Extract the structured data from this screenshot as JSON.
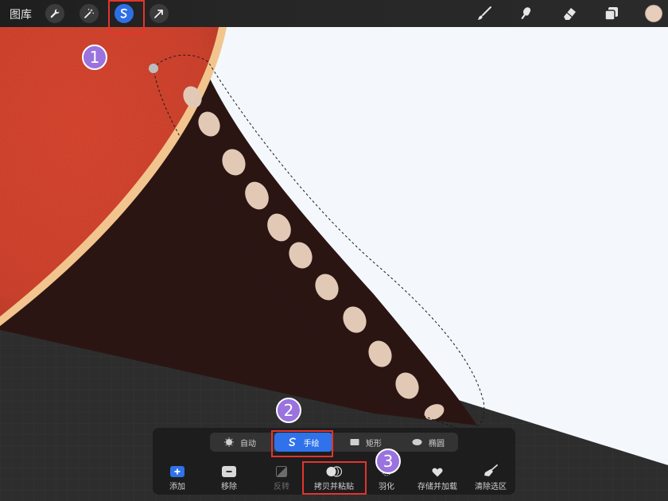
{
  "topbar": {
    "gallery_label": "图库",
    "tools": [
      "wrench-icon",
      "magic-wand-icon",
      "selection-icon",
      "transform-icon"
    ],
    "right_tools": [
      "brush-icon",
      "smudge-icon",
      "eraser-icon",
      "layers-icon"
    ],
    "current_color": "#e7cdbb",
    "active_tool": "selection"
  },
  "selection_panel": {
    "modes": [
      {
        "label": "自动",
        "icon": "auto-icon"
      },
      {
        "label": "手绘",
        "icon": "freehand-icon"
      },
      {
        "label": "矩形",
        "icon": "rectangle-icon"
      },
      {
        "label": "椭圆",
        "icon": "ellipse-icon"
      }
    ],
    "active_mode": "手绘",
    "actions": [
      {
        "label": "添加",
        "icon": "add-icon"
      },
      {
        "label": "移除",
        "icon": "remove-icon"
      },
      {
        "label": "反转",
        "icon": "invert-icon"
      },
      {
        "label": "拷贝并粘贴",
        "icon": "copy-paste-icon"
      },
      {
        "label": "羽化",
        "icon": "feather-icon"
      },
      {
        "label": "存储并加载",
        "icon": "heart-icon"
      },
      {
        "label": "清除选区",
        "icon": "broom-icon"
      }
    ]
  },
  "annotations": {
    "badge_1": "1",
    "badge_2": "2",
    "badge_3": "3",
    "highlight_color": "#e3342f",
    "badge_color": "#9a73de"
  },
  "colors": {
    "accent": "#2f72ea",
    "artwork_red": "#d63d24",
    "artwork_brown": "#2b1513",
    "artwork_dots": "#e2c9b6",
    "canvas_white": "#f4f8fd"
  }
}
